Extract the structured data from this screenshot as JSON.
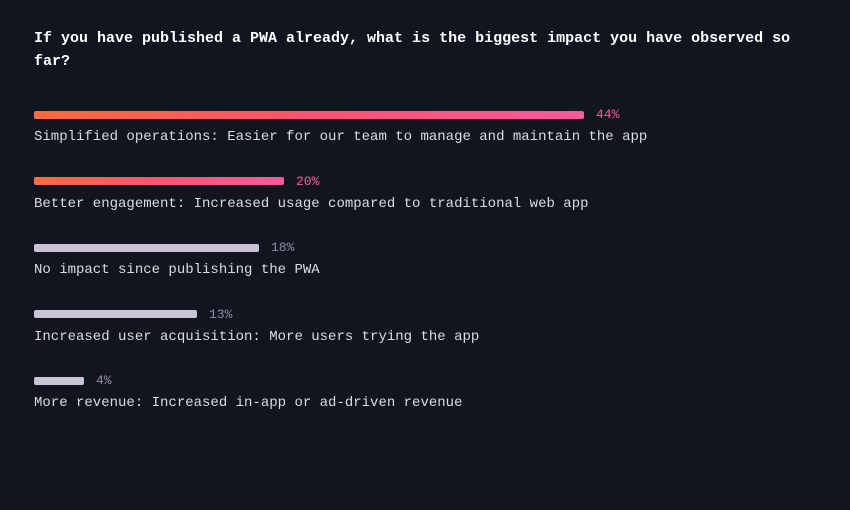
{
  "chart_data": {
    "type": "bar",
    "title": "If you have published a PWA already, what is the biggest impact you have observed so far?",
    "categories": [
      "Simplified operations: Easier for our team to manage and maintain the app",
      "Better engagement: Increased usage compared to traditional web app",
      "No impact since publishing the PWA",
      "Increased user acquisition: More users trying the app",
      "More revenue: Increased in-app or ad-driven revenue"
    ],
    "values": [
      44,
      20,
      18,
      13,
      4
    ],
    "value_labels": [
      "44%",
      "20%",
      "18%",
      "13%",
      "4%"
    ],
    "highlight": [
      true,
      true,
      false,
      false,
      false
    ],
    "xlabel": "",
    "ylabel": "",
    "ylim": [
      0,
      100
    ]
  },
  "colors": {
    "gradient_start": "#ff6b3d",
    "gradient_end": "#ff5a9c",
    "plain_bar": "#c9c3d6",
    "background": "#10151f"
  }
}
